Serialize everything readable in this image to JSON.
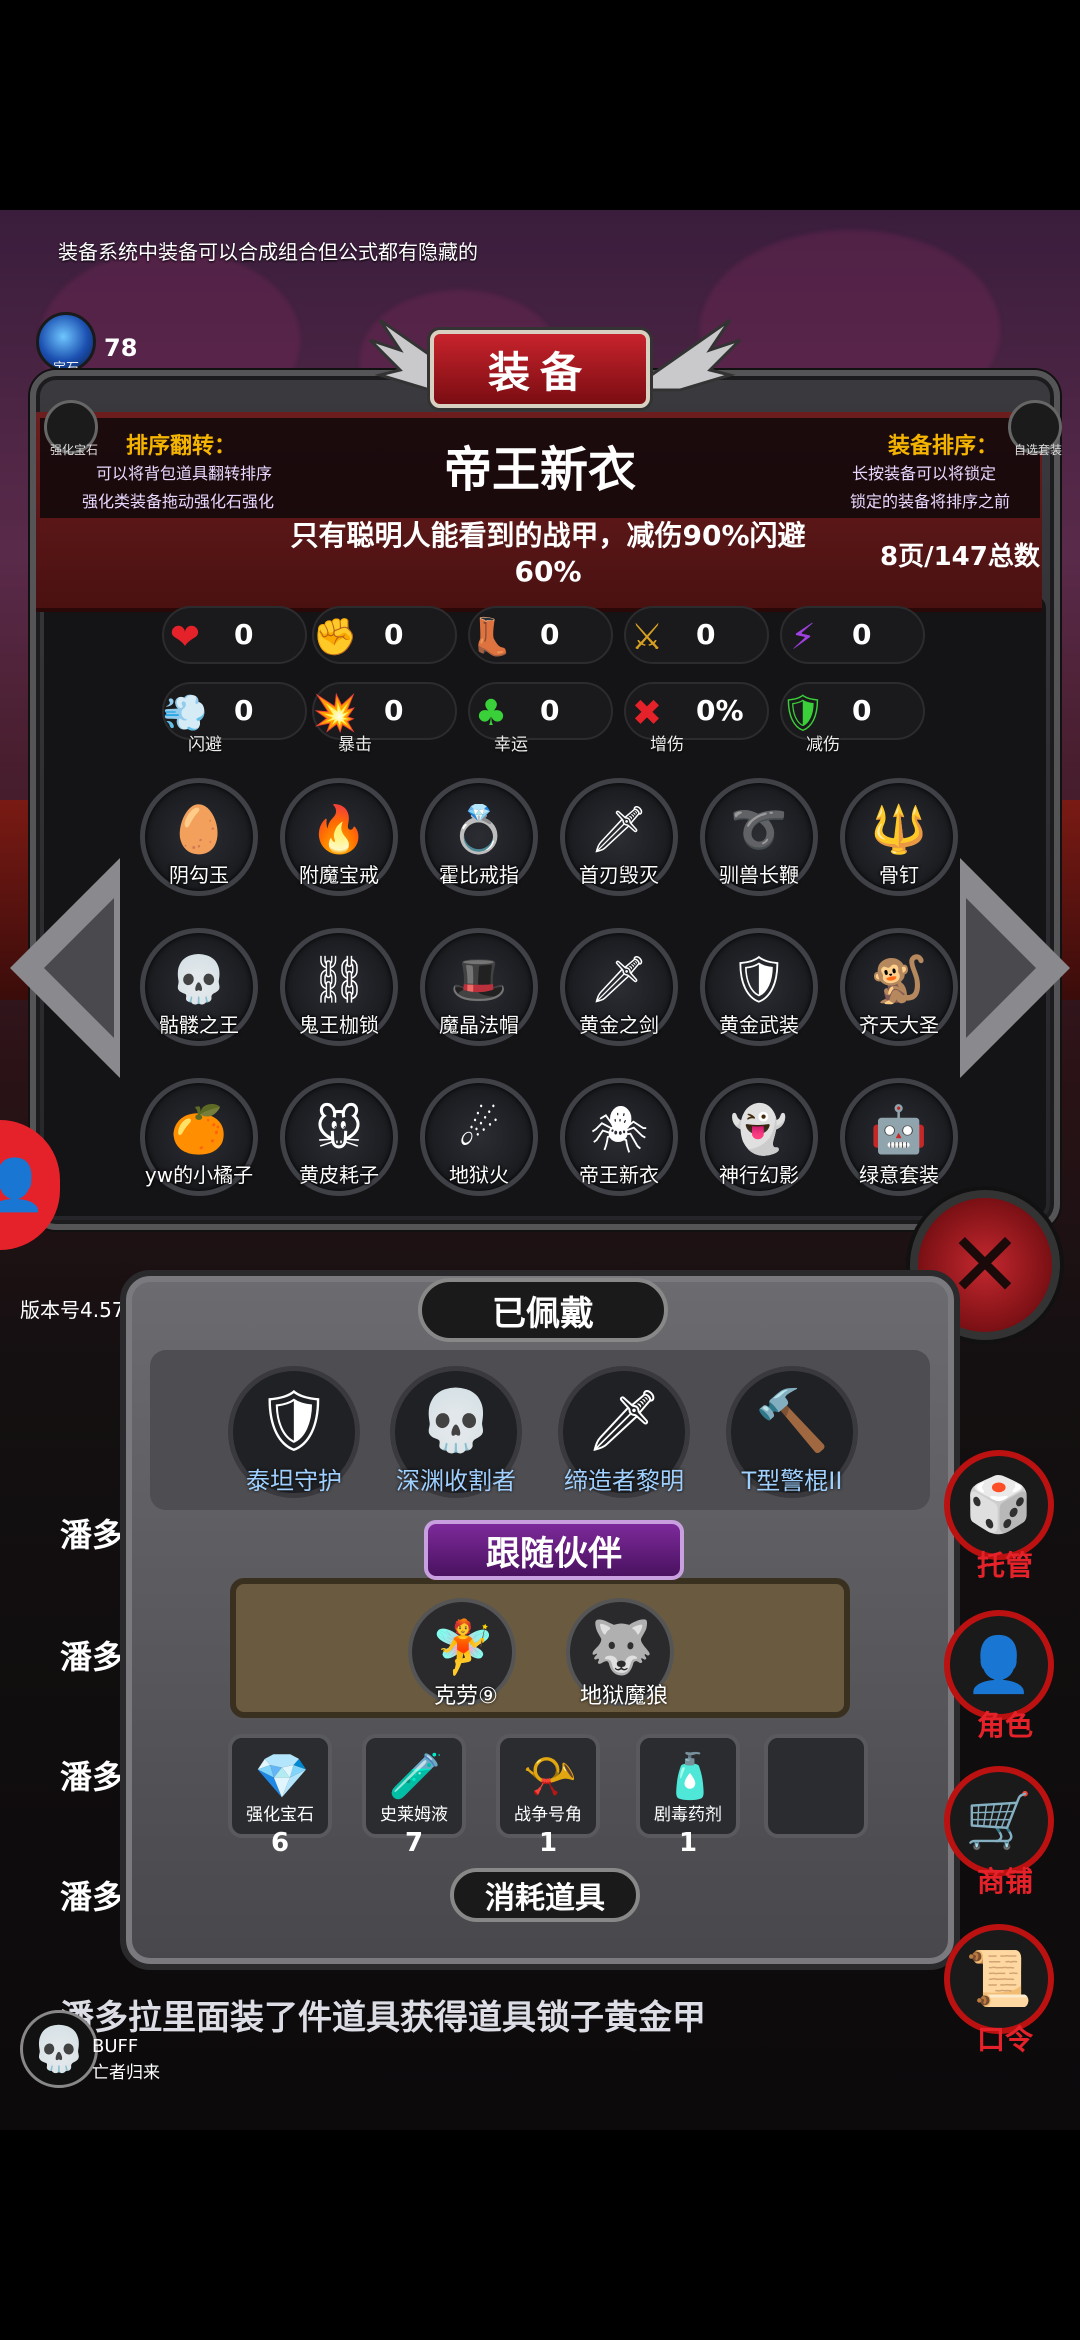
{
  "hint": "装备系统中装备可以合成组合但公式都有隐藏的",
  "gem": {
    "label": "宝石",
    "count": "78"
  },
  "screen_title": "装备",
  "left_mini": {
    "label": "强化宝石"
  },
  "right_mini": {
    "label": "自选套装"
  },
  "sort_flip": {
    "title": "排序翻转：",
    "line1": "可以将背包道具翻转排序",
    "line2": "强化类装备拖动强化石强化"
  },
  "sort_equip": {
    "title": "装备排序：",
    "line1": "长按装备可以将锁定",
    "line2": "锁定的装备将排序之前"
  },
  "selected_item": {
    "name": "帝王新衣",
    "description": "只有聪明人能看到的战甲，减伤90%闪避60%"
  },
  "page_info": "8页/147总数",
  "stats_row1": [
    {
      "icon": "heart-icon",
      "glyph": "❤",
      "color": "#e52229",
      "value": "0"
    },
    {
      "icon": "strength-icon",
      "glyph": "✊",
      "color": "#e8c020",
      "value": "0"
    },
    {
      "icon": "boot-icon",
      "glyph": "👢",
      "color": "#3ab0ff",
      "value": "0"
    },
    {
      "icon": "sword-icon",
      "glyph": "⚔",
      "color": "#d8a020",
      "value": "0"
    },
    {
      "icon": "lightning-icon",
      "glyph": "⚡",
      "color": "#a040e0",
      "value": "0"
    }
  ],
  "stats_row2": [
    {
      "icon": "dodge-icon",
      "glyph": "💨",
      "color": "#3ab0ff",
      "value": "0",
      "label": "闪避"
    },
    {
      "icon": "crit-icon",
      "glyph": "💥",
      "color": "#e8c020",
      "value": "0",
      "label": "暴击"
    },
    {
      "icon": "clover-icon",
      "glyph": "♣",
      "color": "#3ad03a",
      "value": "0",
      "label": "幸运"
    },
    {
      "icon": "damage-icon",
      "glyph": "✖",
      "color": "#e52229",
      "value": "0%",
      "label": "增伤"
    },
    {
      "icon": "shield-icon",
      "glyph": "🛡",
      "color": "#3ad03a",
      "value": "0",
      "label": "减伤"
    }
  ],
  "inventory": [
    {
      "name": "阴勾玉",
      "glyph": "🥚",
      "icon": "purple-jade-icon"
    },
    {
      "name": "附魔宝戒",
      "glyph": "🔥",
      "icon": "enchanted-ring-icon"
    },
    {
      "name": "霍比戒指",
      "glyph": "💍",
      "icon": "hobbit-ring-icon"
    },
    {
      "name": "首刃毁灭",
      "glyph": "🗡",
      "icon": "blade-destroy-icon"
    },
    {
      "name": "驯兽长鞭",
      "glyph": "➰",
      "icon": "whip-icon"
    },
    {
      "name": "骨钉",
      "glyph": "🔱",
      "icon": "bone-nail-icon"
    },
    {
      "name": "骷髅之王",
      "glyph": "💀",
      "icon": "skeleton-king-icon"
    },
    {
      "name": "鬼王枷锁",
      "glyph": "⛓",
      "icon": "ghost-chains-icon"
    },
    {
      "name": "魔晶法帽",
      "glyph": "🎩",
      "icon": "wizard-hat-icon"
    },
    {
      "name": "黄金之剑",
      "glyph": "🗡",
      "icon": "golden-sword-icon"
    },
    {
      "name": "黄金武装",
      "glyph": "🛡",
      "icon": "golden-armor-icon"
    },
    {
      "name": "齐天大圣",
      "glyph": "🐒",
      "icon": "monkey-king-icon"
    },
    {
      "name": "yw的小橘子",
      "glyph": "🍊",
      "icon": "orange-icon"
    },
    {
      "name": "黄皮耗子",
      "glyph": "🐭",
      "icon": "yellow-mouse-icon"
    },
    {
      "name": "地狱火",
      "glyph": "☄",
      "icon": "hellfire-icon"
    },
    {
      "name": "帝王新衣",
      "glyph": "🕷",
      "icon": "emperor-clothes-icon"
    },
    {
      "name": "神行幻影",
      "glyph": "👻",
      "icon": "phantom-icon"
    },
    {
      "name": "绿意套装",
      "glyph": "🤖",
      "icon": "green-suit-icon"
    }
  ],
  "version": "版本号4.57",
  "equipped": {
    "title": "已佩戴",
    "items": [
      {
        "name": "泰坦守护",
        "glyph": "🛡",
        "icon": "titan-guard-icon"
      },
      {
        "name": "深渊收割者",
        "glyph": "💀",
        "icon": "abyss-reaper-icon"
      },
      {
        "name": "缔造者黎明",
        "glyph": "🗡",
        "icon": "creator-dawn-icon"
      },
      {
        "name": "T型警棍II",
        "glyph": "🔨",
        "icon": "baton-icon"
      }
    ]
  },
  "companions": {
    "title": "跟随伙伴",
    "items": [
      {
        "name": "克劳⑨",
        "glyph": "🧚",
        "icon": "claw-fairy-icon"
      },
      {
        "name": "地狱魔狼",
        "glyph": "🐺",
        "icon": "hell-wolf-icon"
      }
    ]
  },
  "consumables": {
    "title": "消耗道具",
    "items": [
      {
        "name": "强化宝石",
        "glyph": "💎",
        "count": "6",
        "icon": "upgrade-gem-icon"
      },
      {
        "name": "史莱姆液",
        "glyph": "🧪",
        "count": "7",
        "icon": "slime-potion-icon"
      },
      {
        "name": "战争号角",
        "glyph": "📯",
        "count": "1",
        "icon": "war-horn-icon"
      },
      {
        "name": "剧毒药剂",
        "glyph": "🧴",
        "count": "1",
        "icon": "poison-potion-icon"
      }
    ]
  },
  "right_buttons": [
    {
      "label": "托管",
      "glyph": "🎲",
      "icon": "dice-icon"
    },
    {
      "label": "角色",
      "glyph": "👤",
      "icon": "hooded-figure-icon"
    },
    {
      "label": "商铺",
      "glyph": "🛒",
      "icon": "shop-icon"
    },
    {
      "label": "口令",
      "glyph": "📜",
      "icon": "scroll-icon"
    }
  ],
  "side_names": [
    "潘多",
    "潘多拉",
    "潘多",
    "潘多"
  ],
  "ticker": "潘多拉里面装了件道具获得道具锁子黄金甲",
  "buff": {
    "label": "BUFF",
    "sub": "亡者归来"
  }
}
